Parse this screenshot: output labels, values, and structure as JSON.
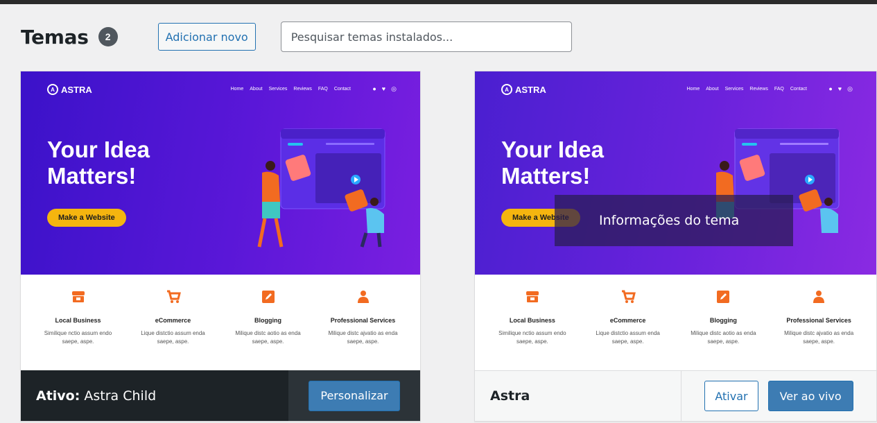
{
  "page": {
    "title": "Temas",
    "count": "2",
    "add_new_label": "Adicionar novo",
    "search_placeholder": "Pesquisar temas instalados..."
  },
  "preview": {
    "logo": "ASTRA",
    "nav": [
      "Home",
      "About",
      "Services",
      "Reviews",
      "FAQ",
      "Contact"
    ],
    "headline": "Your Idea Matters!",
    "cta": "Make a Website",
    "features": [
      {
        "name": "Local Business",
        "desc": "Similique nctio assum endo saepe, aspe.",
        "icon": "store-icon"
      },
      {
        "name": "eCommerce",
        "desc": "Lique distctio assum enda saepe, aspe.",
        "icon": "cart-icon"
      },
      {
        "name": "Blogging",
        "desc": "Milique distc aotio as enda saepe, aspe.",
        "icon": "edit-icon"
      },
      {
        "name": "Professional Services",
        "desc": "Milique distc ajvatio as enda saepe, aspe.",
        "icon": "person-icon"
      }
    ]
  },
  "themes": [
    {
      "active_prefix": "Ativo:",
      "name": "Astra Child",
      "customize_label": "Personalizar"
    },
    {
      "name": "Astra",
      "overlay_label": "Informações do tema",
      "activate_label": "Ativar",
      "live_preview_label": "Ver ao vivo"
    }
  ],
  "colors": {
    "accent": "#2271b1",
    "hero_start": "#3b12c9",
    "hero_end": "#7a1fe0",
    "cta": "#f5b50f",
    "feature_icon": "#f26b21"
  }
}
